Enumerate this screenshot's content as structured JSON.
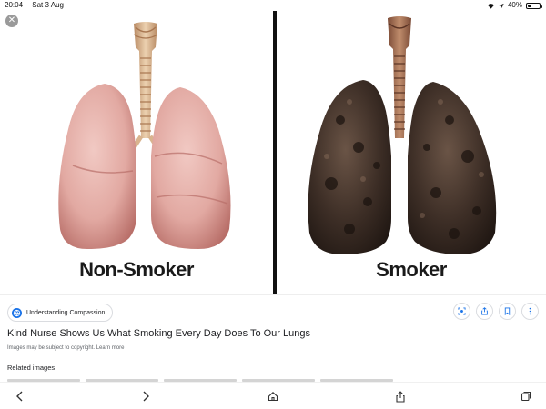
{
  "status_bar": {
    "time": "20:04",
    "date": "Sat 3 Aug",
    "battery": "40%",
    "battery_level": 0.4
  },
  "image": {
    "left_caption": "Non-Smoker",
    "right_caption": "Smoker"
  },
  "result": {
    "source_name": "Understanding Compassion",
    "title": "Kind Nurse Shows Us What Smoking Every Day Does To Our Lungs",
    "copyright_notice": "Images may be subject to copyright.",
    "learn_more": "Learn more",
    "related_heading": "Related images"
  },
  "icons": {
    "close": "close-icon",
    "source": "globe-icon",
    "lens": "lens-icon",
    "share": "share-icon",
    "bookmark": "bookmark-icon",
    "more": "more-vertical-icon",
    "back": "chevron-left-icon",
    "forward": "chevron-right-icon",
    "home": "home-icon",
    "share_toolbar": "share-icon",
    "tabs": "tabs-icon"
  },
  "colors": {
    "accent": "#1a73e8",
    "healthy_lung": "#e2a9a2",
    "smoker_lung": "#3d2e26",
    "trachea": "#d9b48f"
  }
}
